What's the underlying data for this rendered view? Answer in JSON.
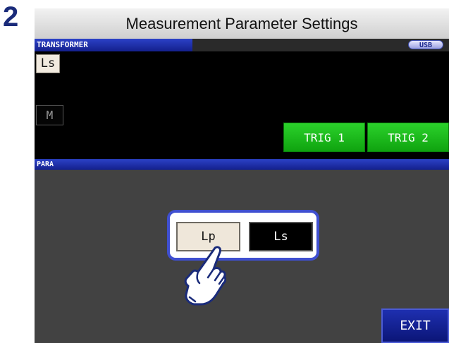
{
  "step": {
    "number": "2"
  },
  "header": {
    "title": "Measurement Parameter Settings"
  },
  "screen": {
    "title": "TRANSFORMER",
    "badge": "USB",
    "params": {
      "primary": "Ls",
      "secondary": "M"
    },
    "triggers": [
      "TRIG 1",
      "TRIG 2"
    ],
    "section_title": "PARA",
    "options": [
      {
        "label": "Lp",
        "selected": true
      },
      {
        "label": "Ls",
        "selected": false
      }
    ],
    "exit_label": "EXIT"
  },
  "colors": {
    "accent_blue": "#14208c",
    "trigger_green": "#1fbf1f",
    "panel_gray": "#424242",
    "highlight_blue": "#3f4fd0"
  },
  "icons": {
    "pointer": "pointing-hand-icon"
  }
}
